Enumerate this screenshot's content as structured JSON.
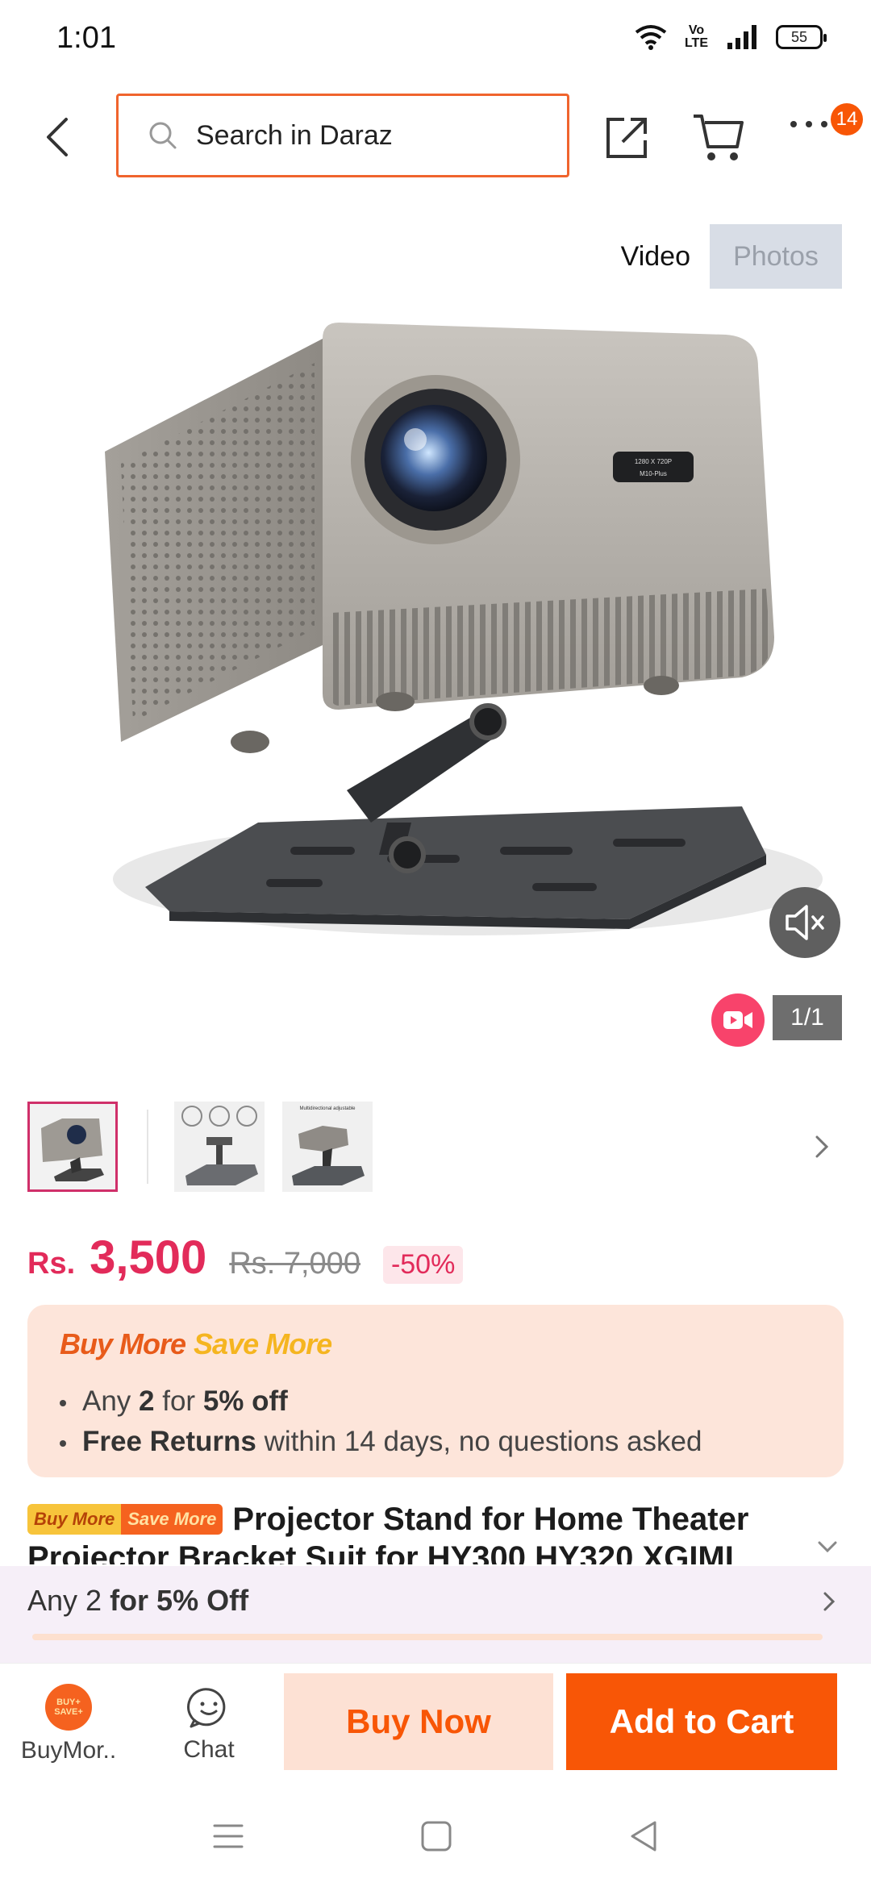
{
  "status_bar": {
    "time": "1:01",
    "volte_top": "Vo",
    "volte_bottom": "LTE",
    "battery": "55"
  },
  "search": {
    "placeholder": "Search in Daraz"
  },
  "cart": {
    "badge": "14"
  },
  "media_toggle": {
    "video_label": "Video",
    "photos_label": "Photos"
  },
  "product_image_label": {
    "line1": "1280 X 720P",
    "line2": "M10-Plus"
  },
  "gallery": {
    "counter": "1/1",
    "thumb2_caption": "",
    "thumb3_caption": "Multidirectional adjustable"
  },
  "price": {
    "currency": "Rs.",
    "value": "3,500",
    "original": "Rs. 7,000",
    "discount": "-50%"
  },
  "promo": {
    "title_buy": "Buy More",
    "title_save": "Save More",
    "line1_pre": "Any ",
    "line1_qty": "2",
    "line1_mid": " for ",
    "line1_off": "5% off",
    "line2_bold": "Free Returns",
    "line2_rest": " within 14 days, no questions asked"
  },
  "product": {
    "badge_buy": "Buy More",
    "badge_save": "Save More",
    "title": "Projector Stand for Home Theater Projector Bracket Suit for HY300 HY320 XGIMI"
  },
  "bundle": {
    "pre": "Any 2 ",
    "bold": "for 5% Off"
  },
  "bottom_bar": {
    "buymore_icon_top": "BUY+",
    "buymore_icon_bottom": "SAVE+",
    "buymore_label": "BuyMor..",
    "chat_label": "Chat",
    "buy_now": "Buy Now",
    "add_to_cart": "Add to Cart"
  },
  "colors": {
    "brand_orange": "#f85606",
    "price_red": "#e22b5a",
    "promo_bg": "#fde5da"
  }
}
